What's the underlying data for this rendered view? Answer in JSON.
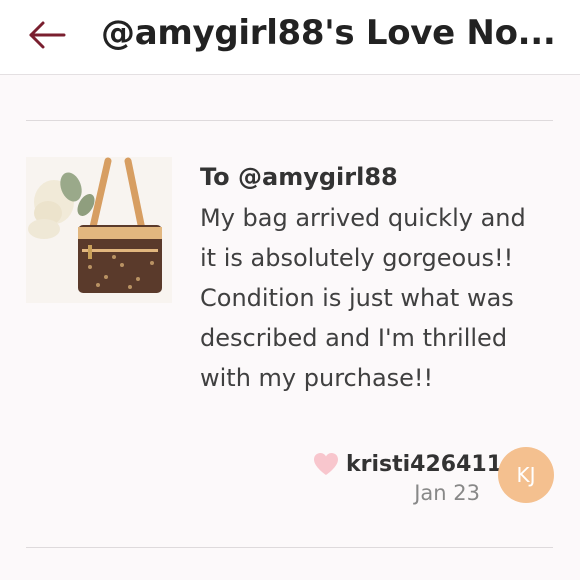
{
  "header": {
    "title": "@amygirl88's Love No..."
  },
  "note": {
    "to": "To @amygirl88",
    "body": "My bag arrived quickly and it is absolutely gorgeous!! Condition is just what was described and I'm thrilled with my purchase!!",
    "author": "kristi426411",
    "date": "Jan 23",
    "avatar_initials": "KJ"
  },
  "icons": {
    "back": "back-arrow-icon",
    "like": "heart-icon"
  },
  "colors": {
    "back_arrow": "#7a1f2f",
    "avatar_bg": "#f4c08f",
    "heart": "#f8c6cd"
  }
}
